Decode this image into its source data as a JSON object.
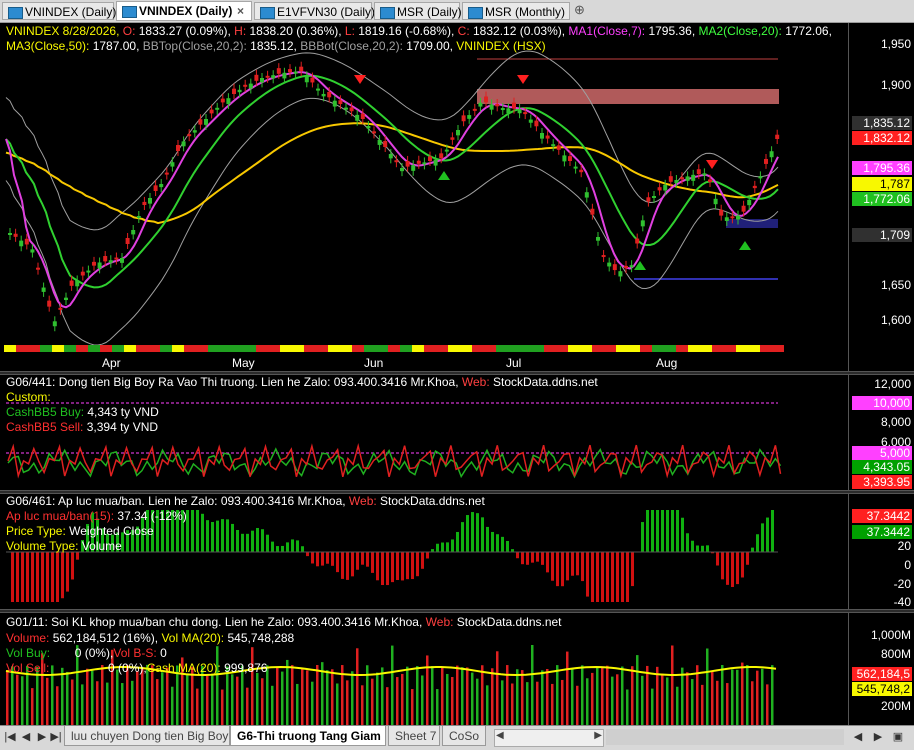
{
  "tabs": [
    {
      "label": "VNINDEX (Daily)",
      "active": false
    },
    {
      "label": "VNINDEX (Daily)",
      "active": true,
      "close": "×"
    },
    {
      "label": "E1VFVN30 (Daily)",
      "active": false
    },
    {
      "label": "MSR (Daily)",
      "active": false
    },
    {
      "label": "MSR (Monthly)",
      "active": false
    }
  ],
  "new_tab_glyph": "⊕",
  "price_panel": {
    "legend": [
      {
        "text": "VNINDEX 8/28/2026, ",
        "color": "#f8f800"
      },
      {
        "text": "O: ",
        "color": "#ff4040"
      },
      {
        "text": "1833.27 (0.09%), ",
        "color": "#ffffff"
      },
      {
        "text": "H: ",
        "color": "#ff4040"
      },
      {
        "text": "1838.20 (0.36%), ",
        "color": "#ffffff"
      },
      {
        "text": "L: ",
        "color": "#ff4040"
      },
      {
        "text": "1819.16 (-0.68%), ",
        "color": "#ffffff"
      },
      {
        "text": "C: ",
        "color": "#ff4040"
      },
      {
        "text": "1832.12 (0.03%), ",
        "color": "#ffffff"
      },
      {
        "text": "MA1(Close,7): ",
        "color": "#ff40ff"
      },
      {
        "text": "1795.36, ",
        "color": "#ffffff"
      },
      {
        "text": "MA2(Close,20): ",
        "color": "#40ff40"
      },
      {
        "text": "1772.06,",
        "color": "#ffffff"
      }
    ],
    "legend2": [
      {
        "text": "MA3(Close,50): ",
        "color": "#f8f800"
      },
      {
        "text": "1787.00, ",
        "color": "#ffffff"
      },
      {
        "text": "BBTop(Close,20,2): ",
        "color": "#a0a0a0"
      },
      {
        "text": "1835.12, ",
        "color": "#ffffff"
      },
      {
        "text": "BBBot(Close,20,2): ",
        "color": "#a0a0a0"
      },
      {
        "text": "1709.00, ",
        "color": "#ffffff"
      },
      {
        "text": "VNINDEX (HSX)",
        "color": "#f8f800"
      }
    ],
    "y_ticks": [
      "1,950",
      "1,900",
      "1,850",
      "1,800",
      "1,750",
      "1,700",
      "1,650",
      "1,600"
    ],
    "months": [
      "Apr",
      "May",
      "Jun",
      "Jul",
      "Aug"
    ],
    "tags": [
      {
        "text": "1,835.12",
        "bg": "#303030",
        "fg": "#ffffff"
      },
      {
        "text": "1,832.12",
        "bg": "#ff2020",
        "fg": "#ffffff"
      },
      {
        "text": "1,795.36",
        "bg": "#ff40ff",
        "fg": "#ffffff"
      },
      {
        "text": "1,787",
        "bg": "#f8f800",
        "fg": "#000000"
      },
      {
        "text": "1,772.06",
        "bg": "#20c020",
        "fg": "#ffffff"
      },
      {
        "text": "1,709",
        "bg": "#303030",
        "fg": "#ffffff"
      }
    ]
  },
  "flow_panel": {
    "title": "G06/441: Dong tien Big Boy Ra Vao Thi truong. Lien he Zalo: ",
    "zalo": "093.400.3416 Mr.Khoa, ",
    "web_label": "Web: ",
    "web": "StockData.ddns.net",
    "custom": "Custom:",
    "buy_label": "CashBB5 Buy: ",
    "buy_value": "4,343 ty VND",
    "sell_label": "CashBB5 Sell: ",
    "sell_value": "3,394 ty VND",
    "y_ticks": [
      "12,000",
      "8,000",
      "6,000",
      "4,000"
    ],
    "tags": [
      {
        "text": "10,000",
        "bg": "#ff40ff",
        "fg": "#ffffff"
      },
      {
        "text": "5,000",
        "bg": "#ff40ff",
        "fg": "#ffffff"
      },
      {
        "text": "4,343.05",
        "bg": "#00a000",
        "fg": "#ffffff"
      },
      {
        "text": "3,393.95",
        "bg": "#ff2020",
        "fg": "#ffffff"
      }
    ]
  },
  "pressure_panel": {
    "title": "G06/461: Ap luc mua/ban. Lien he Zalo: ",
    "zalo": "093.400.3416 Mr.Khoa, ",
    "web_label": "Web: ",
    "web": "StockData.ddns.net",
    "line1_label": "Ap luc mua/ban(15): ",
    "line1_value": "37.34 (-12%)",
    "price_type_label": "Price Type: ",
    "price_type_value": "Weighted Close",
    "volume_type_label": "Volume Type: ",
    "volume_type_value": "Volume",
    "y_ticks": [
      "20",
      "0",
      "-20",
      "-40"
    ],
    "tags": [
      {
        "text": "37.3442",
        "bg": "#ff2020",
        "fg": "#ffffff"
      },
      {
        "text": "37.3442",
        "bg": "#00a000",
        "fg": "#ffffff"
      }
    ]
  },
  "volume_panel": {
    "title": "G01/11: Soi KL khop mua/ban chu dong. Lien he Zalo: ",
    "zalo": "093.400.3416 Mr.Khoa, ",
    "web_label": "Web: ",
    "web": "StockData.ddns.net",
    "volume_label": "Volume: ",
    "volume_value": "562,184,512 (16%), ",
    "vma_label": "Vol MA(20): ",
    "vma_value": "545,748,288",
    "vbuy_label": "Vol Buy: ",
    "vbuy_value": "0 (0%), ",
    "vbs_label": "Vol B-S: ",
    "vbs_value": "0",
    "vsell_label": "Vol Sell: ",
    "vsell_value": "0 (0%), ",
    "cma_label": "Cash MA(20): ",
    "cma_value": "999,876",
    "y_ticks": [
      "1,000M",
      "800M",
      "600M",
      "400M",
      "200M"
    ],
    "tags": [
      {
        "text": "562,184,5",
        "bg": "#ff2020",
        "fg": "#ffffff"
      },
      {
        "text": "545,748,2",
        "bg": "#f8f800",
        "fg": "#000000"
      }
    ]
  },
  "sheets": [
    {
      "label": "luu chuyen Dong tien Big Boy",
      "active": false
    },
    {
      "label": "G6-Thi truong Tang Giam",
      "active": true
    },
    {
      "label": "Sheet 7",
      "active": false
    },
    {
      "label": "CoSo",
      "active": false
    }
  ]
}
